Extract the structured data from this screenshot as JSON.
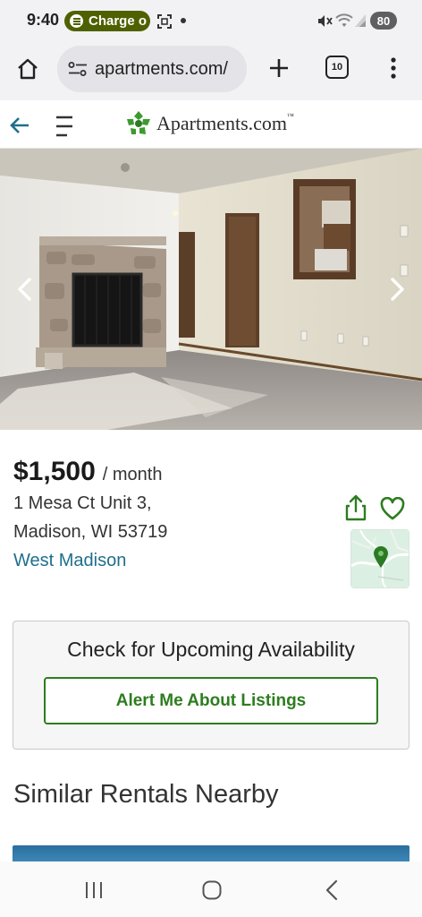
{
  "status_bar": {
    "time": "9:40",
    "media_pill": "Charge o",
    "battery": "80",
    "icons": [
      "spotify-icon",
      "screenshot-icon",
      "dot-icon",
      "mute-icon",
      "wifi-icon",
      "signal-icon"
    ]
  },
  "browser": {
    "url": "apartments.com/",
    "tab_count": "10",
    "icons": [
      "home-icon",
      "site-settings-icon",
      "new-tab-icon",
      "tabs-icon",
      "more-icon"
    ]
  },
  "site": {
    "logo_text": "Apartments.com",
    "logo_tm": "™",
    "icons": [
      "back-arrow-icon",
      "menu-icon",
      "apartments-logo-icon"
    ]
  },
  "listing": {
    "price": "$1,500",
    "per": "/ month",
    "address_line1": "1 Mesa Ct Unit 3,",
    "address_line2": "Madison, WI 53719",
    "neighborhood": "West Madison",
    "icons": [
      "share-icon",
      "heart-icon",
      "map-pin-icon",
      "chevron-left-icon",
      "chevron-right-icon"
    ]
  },
  "availability": {
    "title": "Check for Upcoming Availability",
    "button": "Alert Me About Listings"
  },
  "similar": {
    "title": "Similar Rentals Nearby"
  },
  "nav": {
    "icons": [
      "recent-apps-icon",
      "home-button-icon",
      "back-button-icon"
    ]
  },
  "colors": {
    "brand_green": "#2d7d1f",
    "link_blue": "#1f6f8b",
    "pill_green": "#4e6100"
  }
}
